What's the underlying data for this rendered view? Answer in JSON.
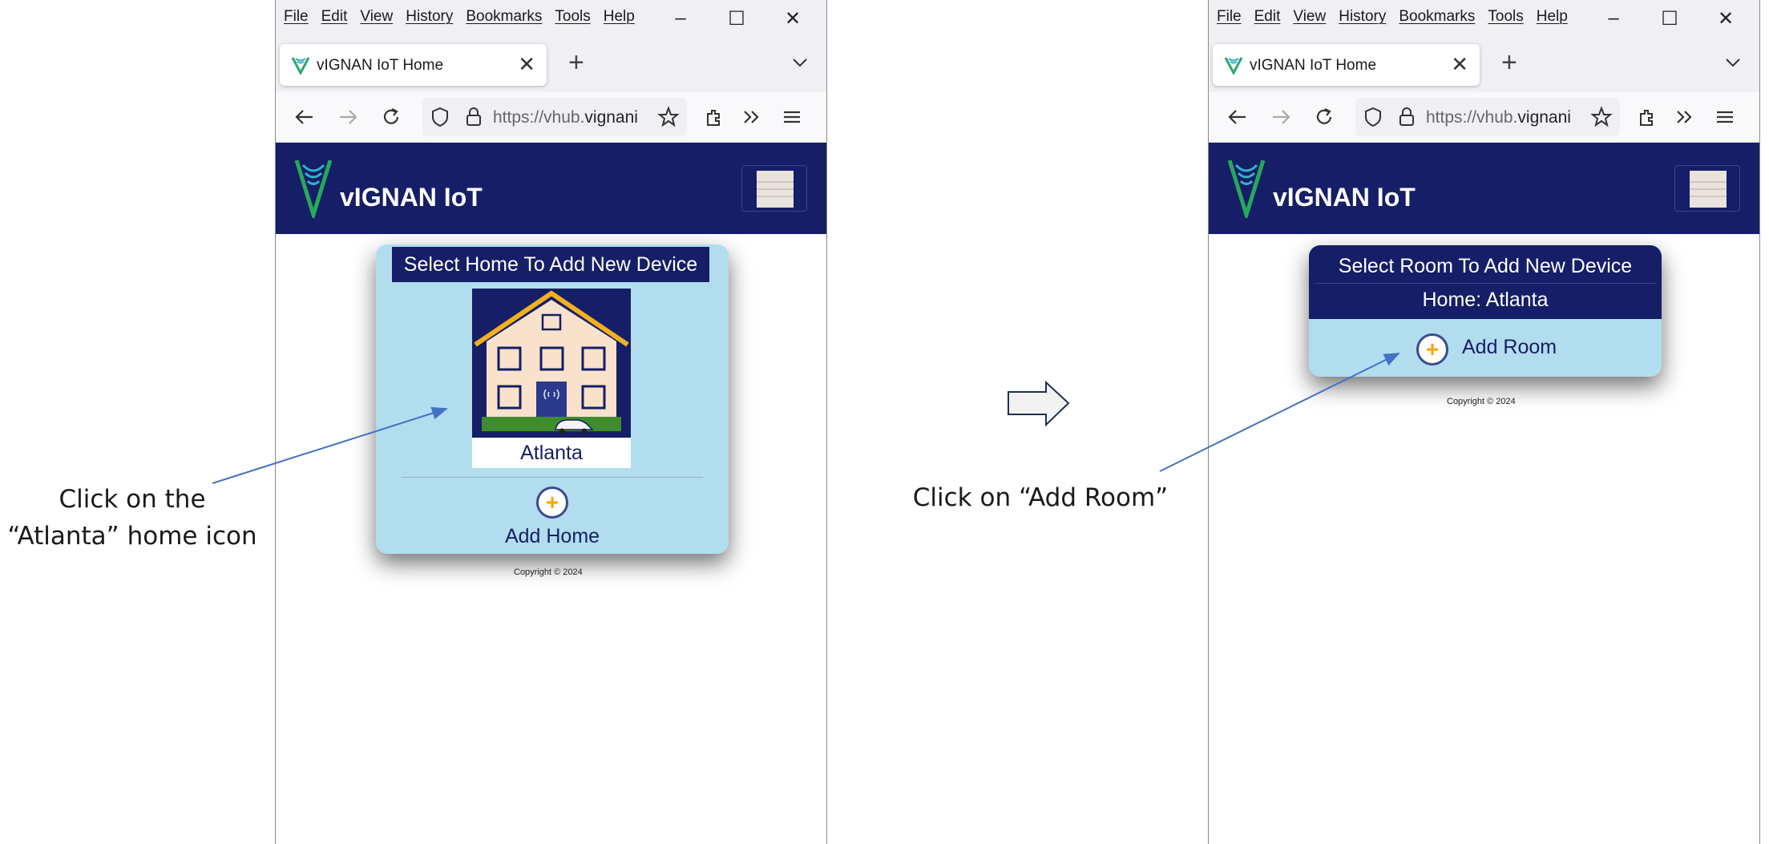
{
  "browser": {
    "menu": [
      "File",
      "Edit",
      "View",
      "History",
      "Bookmarks",
      "Tools",
      "Help"
    ],
    "window_controls": {
      "minimize": "–",
      "maximize": "☐",
      "close": "✕"
    },
    "tab_title": "vIGNAN IoT Home",
    "tab_close": "✕",
    "new_tab": "+",
    "url_prefix": "https://vhub.",
    "url_domain": "vignani"
  },
  "app": {
    "brand": "vIGNAN IoT",
    "copyright": "Copyright © 2024"
  },
  "left_screen": {
    "card_title": "Select Home To Add New Device",
    "home_name": "Atlanta",
    "add_label": "Add Home",
    "add_symbol": "+"
  },
  "right_screen": {
    "card_title": "Select Room To Add New Device",
    "home_label": "Home: Atlanta",
    "add_label": "Add Room",
    "add_symbol": "+"
  },
  "annotations": {
    "left_line1": "Click on the",
    "left_line2": "“Atlanta” home icon",
    "right": "Click on “Add Room”"
  },
  "colors": {
    "header_navy": "#151e66",
    "card_blue": "#b1ddee",
    "accent_orange": "#f2a60c",
    "arrow_blue": "#4472c4"
  }
}
